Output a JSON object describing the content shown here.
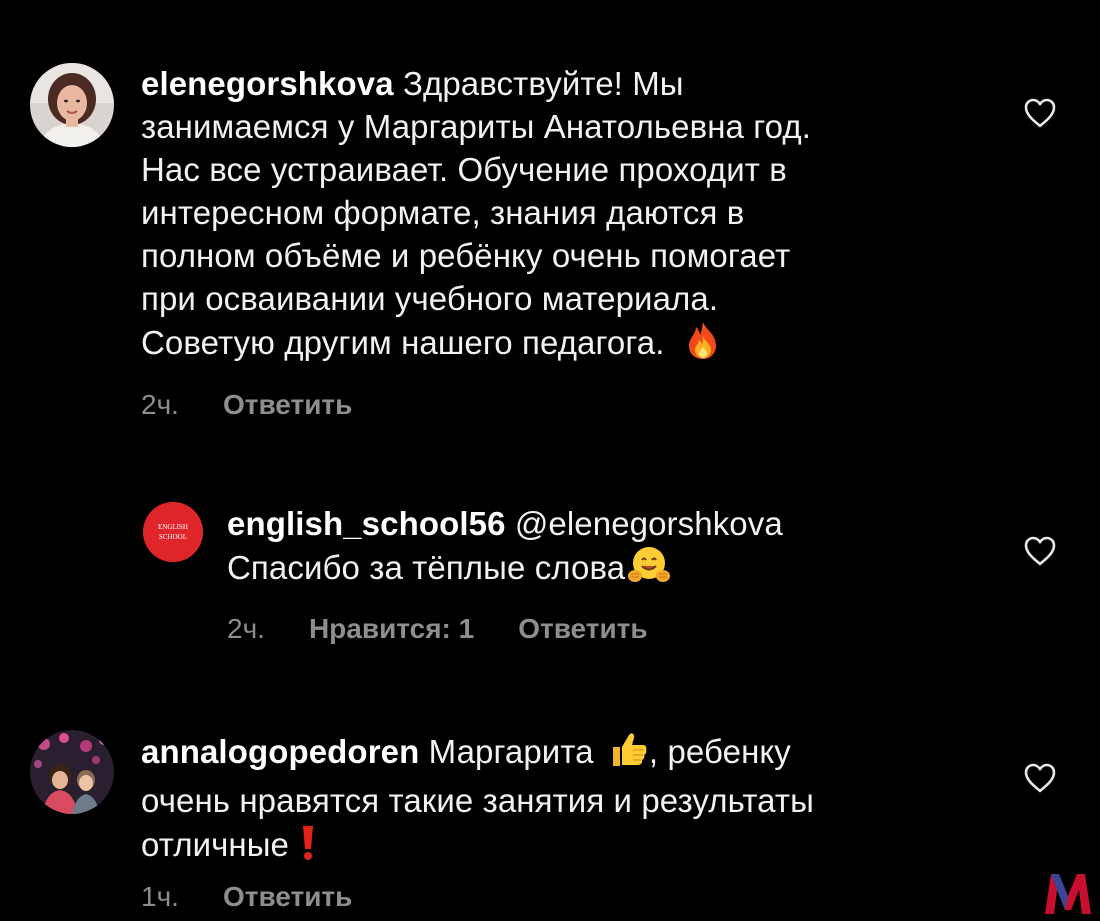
{
  "colors": {
    "background": "#000000",
    "text": "#f2f2f2",
    "meta": "#8e8e8e",
    "school_avatar": "#e0262b",
    "watermark": "#c8102e"
  },
  "comments": [
    {
      "username": "elenegorshkova",
      "text_lines": [
        "Здравствуйте! Мы",
        "занимаемся у Маргариты Анатольевна год.",
        "Нас все устраивает. Обучение проходит в",
        "интересном формате, знания даются в",
        "полном объёме и ребёнку очень помогает",
        "при осваивании учебного материала.",
        "Советую другим нашего педагога."
      ],
      "emoji": "fire-emoji",
      "time": "2ч.",
      "reply_label": "Ответить",
      "like_icon": "heart-outline-icon"
    },
    {
      "username": "english_school56",
      "mention": "@elenegorshkova",
      "text": "Спасибо за тёплые слова",
      "emoji": "hugging-face-emoji",
      "avatar_text_1": "ENGLISH",
      "avatar_text_2": "SCHOOL",
      "time": "2ч.",
      "likes_label": "Нравится: 1",
      "reply_label": "Ответить",
      "like_icon": "heart-outline-icon"
    },
    {
      "username": "annalogopedoren",
      "text_part_1": "Маргарита",
      "text_part_2": ", ребенку",
      "text_line_2": "очень нравятся такие занятия и результаты",
      "text_line_3": "отличные",
      "emoji_1": "thumbs-up-emoji",
      "emoji_2": "exclamation-emoji",
      "time": "1ч.",
      "reply_label": "Ответить",
      "like_icon": "heart-outline-icon"
    }
  ],
  "watermark": "M-logo"
}
